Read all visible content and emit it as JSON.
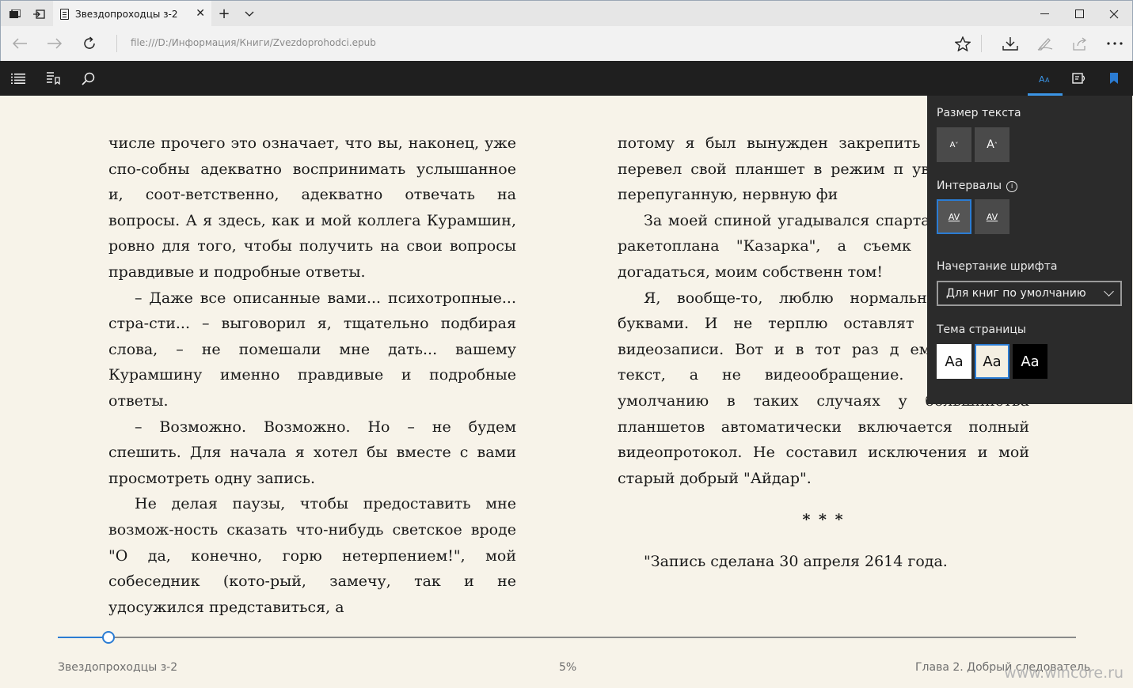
{
  "browser": {
    "tab_title": "Звездопроходцы з-2",
    "url": "file:///D:/Информация/Книги/Zvezdoprohodci.epub"
  },
  "book": {
    "left_column": [
      {
        "indent": false,
        "text": "числе прочего это означает, что вы, наконец, уже спо-собны адекватно воспринимать услышанное и, соот-ветственно, адекватно отвечать на вопросы. А я здесь, как и мой коллега Курамшин, ровно для того, чтобы получить на свои вопросы правдивые и подробные ответы."
      },
      {
        "indent": true,
        "text": "– Даже все описанные вами... психотропные... стра-сти... – выговорил я, тщательно подбирая слова, – не помешали мне дать... вашему Курамшину именно правдивые и подробные ответы."
      },
      {
        "indent": true,
        "text": "– Возможно. Возможно. Но – не будем спешить. Для начала я хотел бы вместе с вами просмотреть одну запись."
      },
      {
        "indent": true,
        "text": "Не делая паузы, чтобы предоставить мне возмож-ность сказать что-нибудь светское вроде \"О да, конечно, горю нетерпением!\", мой собеседник (кото-рый, замечу, так и не удосужился представиться, а"
      }
    ],
    "right_column": [
      {
        "indent": false,
        "text": "потому я был вынужден закрепить за Ревизор) перевел свой планшет в режим п увидел... свою перепуганную, нервную фи"
      },
      {
        "indent": true,
        "text": "За моей спиной угадывался спартанск кубрика ракетоплана \"Казарка\", а съемк легко было догадаться, моим собственн том!"
      },
      {
        "indent": true,
        "text": "Я, вообще-то, люблю нормальные записки буквами. И не терплю оставлят всякие там видеозаписи. Вот и в тот раз д ему планшету текст, а не видеообращение. Однако по умолчанию в таких случаях у большинства планшетов автоматически включается полный видеопротокол. Не составил исключения и мой старый добрый \"Айдар\"."
      }
    ],
    "separator": "* * *",
    "closing_line": "\"Запись сделана 30 апреля 2614 года."
  },
  "footer": {
    "book_title": "Звездопроходцы з-2",
    "progress_label": "5%",
    "progress_fraction": 0.05,
    "chapter": "Глава 2. Добрый следователь",
    "watermark": "www.wincore.ru"
  },
  "settings_panel": {
    "text_size_label": "Размер текста",
    "decrease_label": "A",
    "increase_label": "A",
    "spacing_label": "Интервалы",
    "spacing_option_1": "AV",
    "spacing_option_2": "AV",
    "font_label": "Начертание шрифта",
    "font_value": "Для книг по умолчанию",
    "theme_label": "Тема страницы",
    "theme_white": "Aa",
    "theme_sepia": "Aa",
    "theme_black": "Aa"
  },
  "colors": {
    "accent": "#2b7cd3",
    "page_background": "#f7f3e9",
    "reader_bar": "#1f1f1f",
    "panel": "#2b2b2b"
  }
}
